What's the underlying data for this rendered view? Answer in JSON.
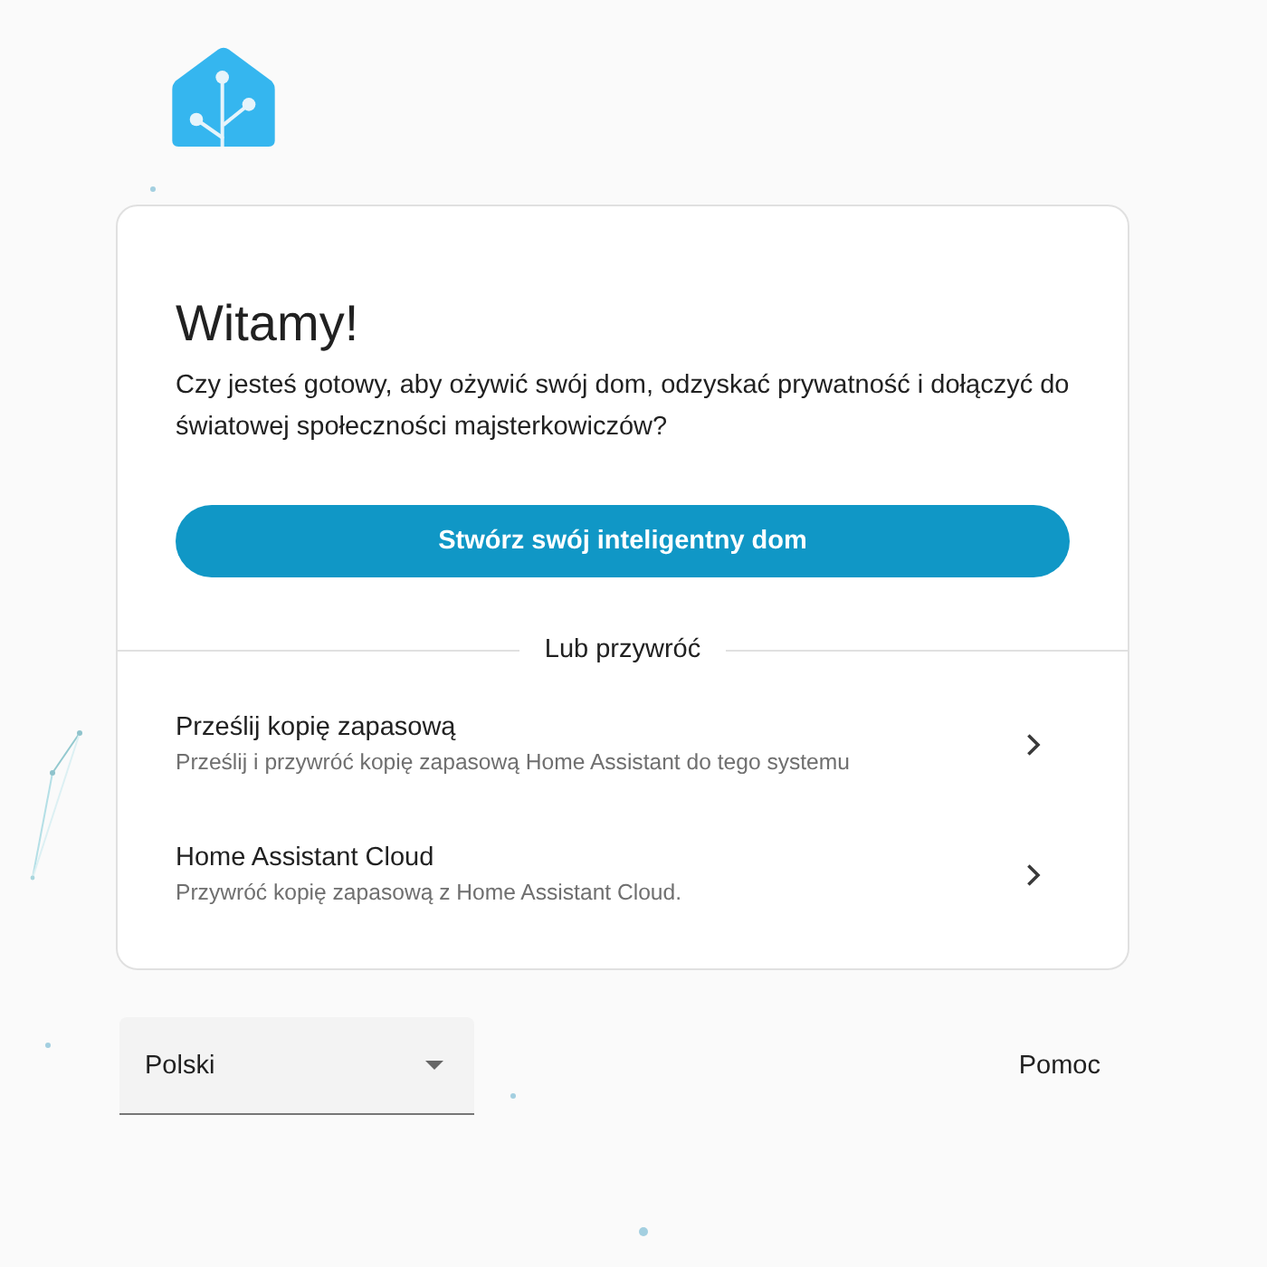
{
  "card": {
    "title": "Witamy!",
    "intro": "Czy jesteś gotowy, aby ożywić swój dom, odzyskać prywatność i dołączyć do światowej społeczności majsterkowiczów?",
    "primary_button": "Stwórz swój inteligentny dom",
    "divider_label": "Lub przywróć",
    "options": [
      {
        "title": "Prześlij kopię zapasową",
        "description": "Prześlij i przywróć kopię zapasową Home Assistant do tego systemu"
      },
      {
        "title": "Home Assistant Cloud",
        "description": "Przywróć kopię zapasową z Home Assistant Cloud."
      }
    ]
  },
  "footer": {
    "language_select": {
      "value": "Polski"
    },
    "help_link": "Pomoc"
  }
}
